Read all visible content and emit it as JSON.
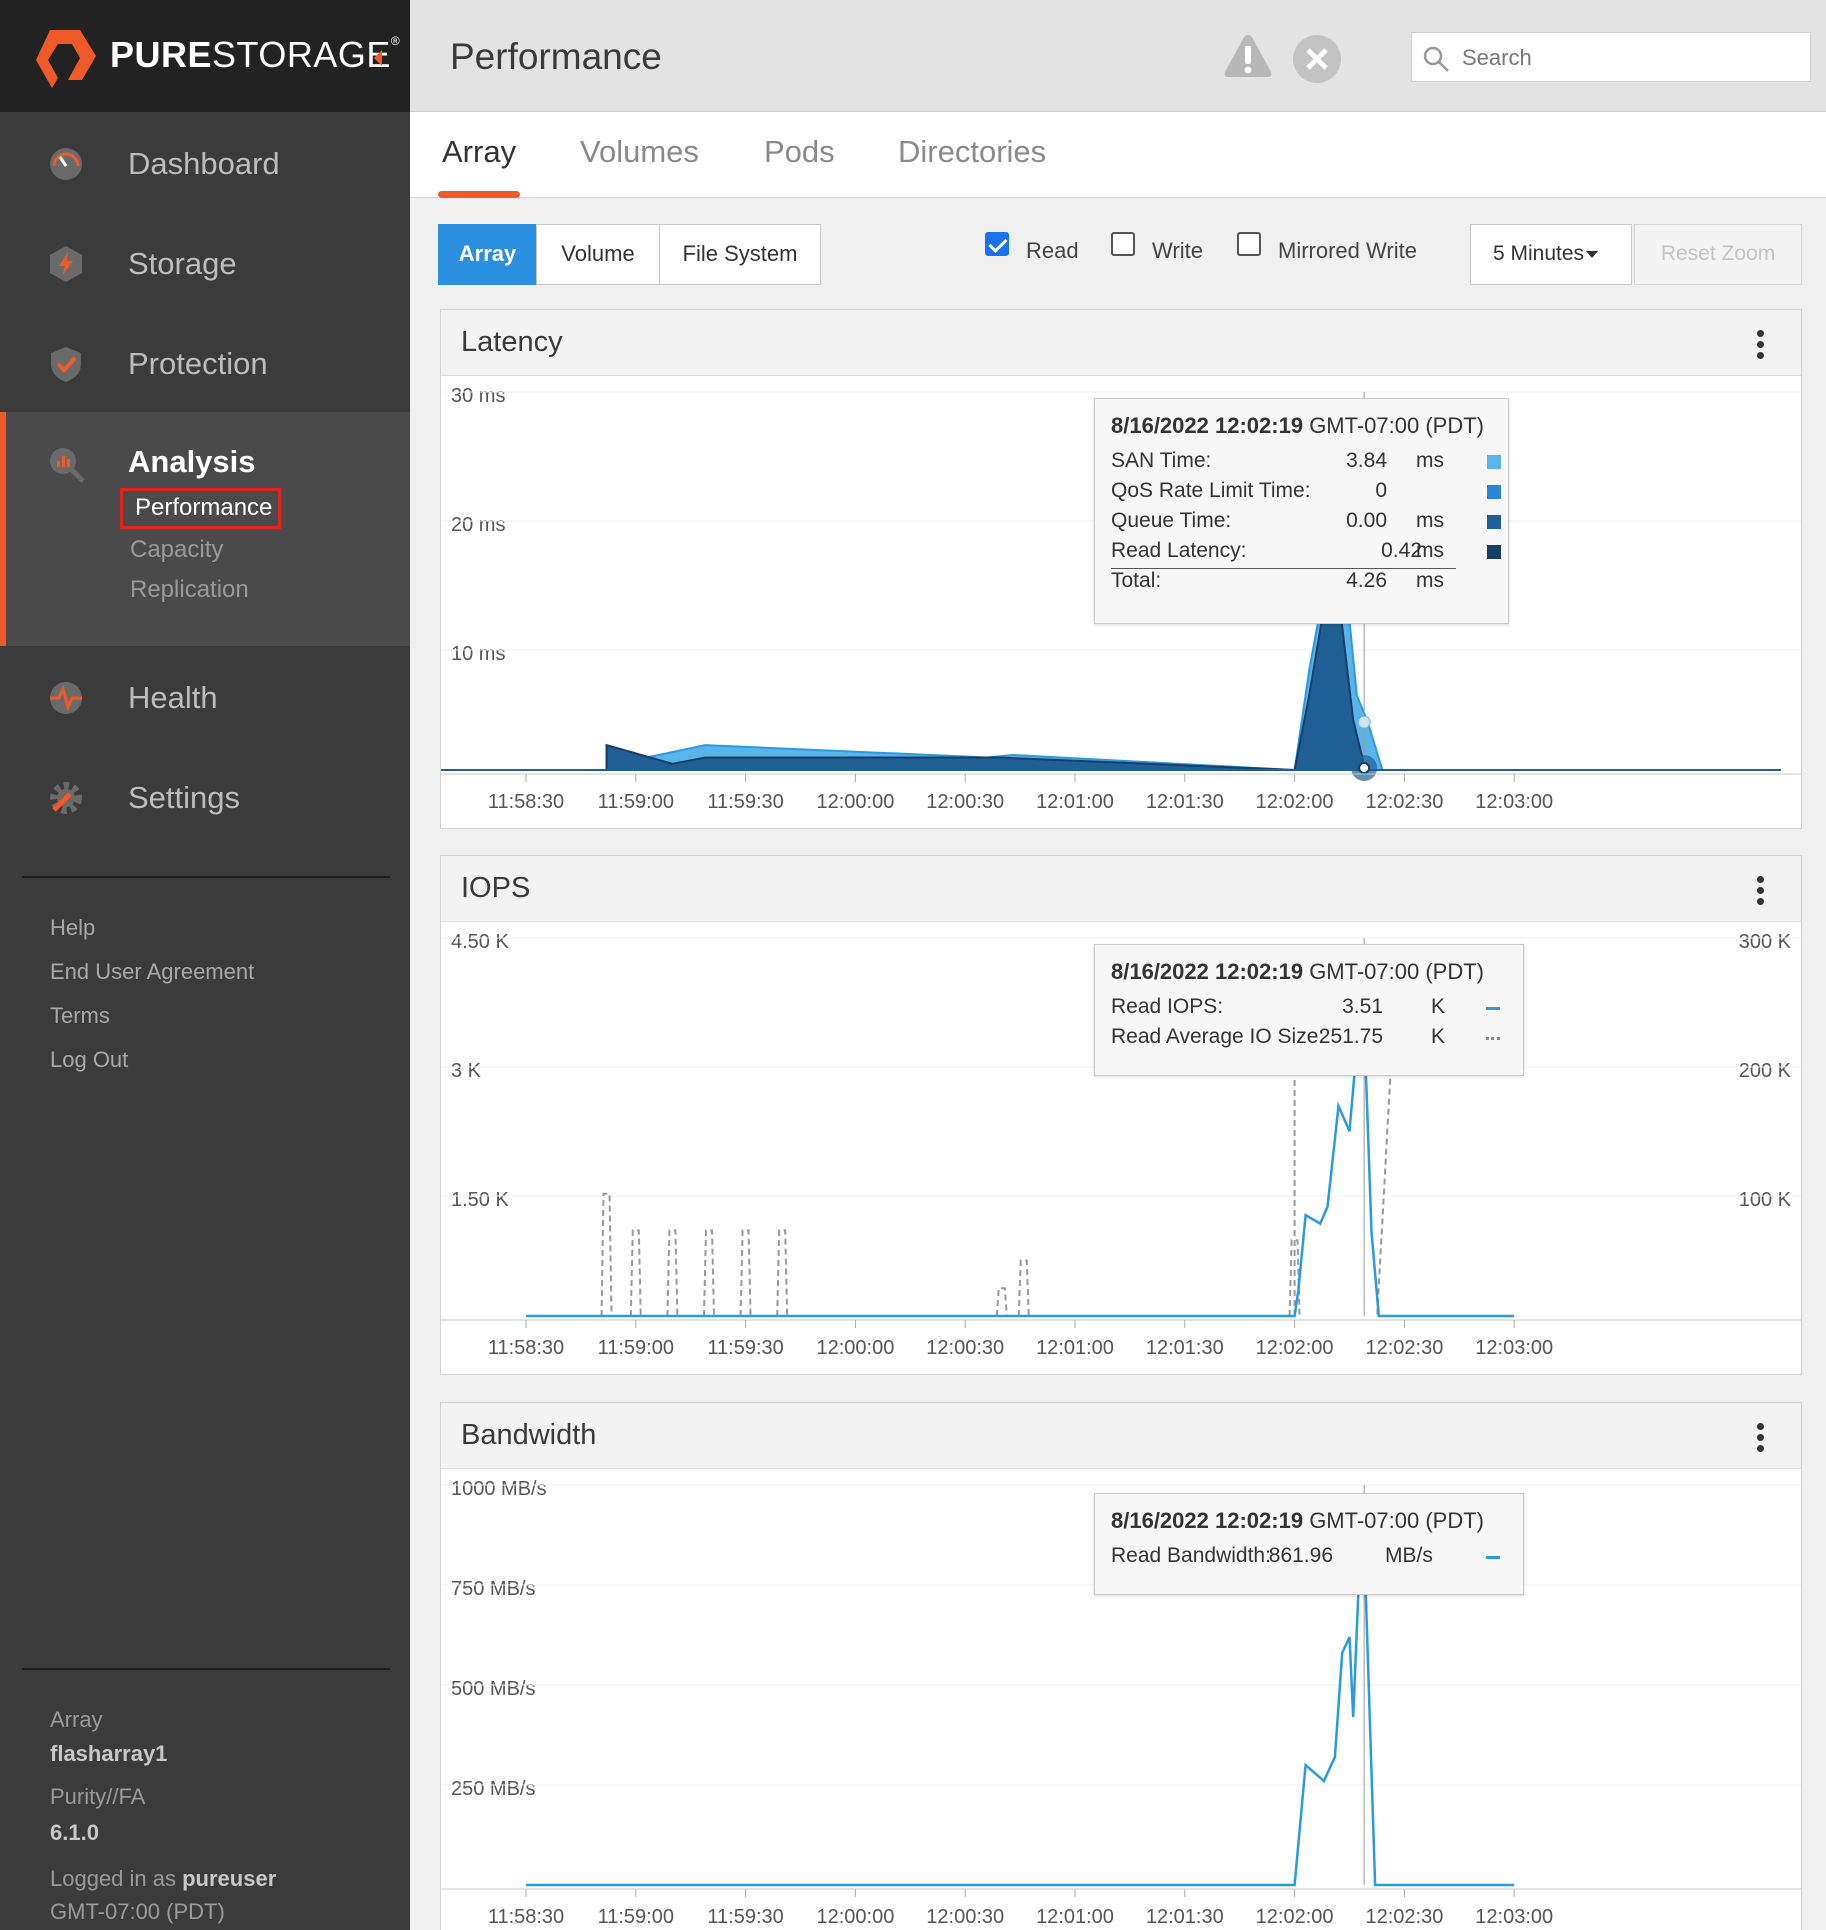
{
  "brand": {
    "name_bold": "PURE",
    "name_light": "STORAGE",
    "mark": "®"
  },
  "sidebar": {
    "nav": [
      {
        "label": "Dashboard",
        "icon": "dashboard-gauge-icon"
      },
      {
        "label": "Storage",
        "icon": "storage-bolt-icon"
      },
      {
        "label": "Protection",
        "icon": "shield-check-icon"
      },
      {
        "label": "Analysis",
        "icon": "analysis-magnifier-icon"
      },
      {
        "label": "Health",
        "icon": "health-pulse-icon"
      },
      {
        "label": "Settings",
        "icon": "gear-icon"
      }
    ],
    "analysis_sub": [
      "Performance",
      "Capacity",
      "Replication"
    ],
    "links": [
      "Help",
      "End User Agreement",
      "Terms",
      "Log Out"
    ],
    "footer": {
      "array_label": "Array",
      "array_name": "flasharray1",
      "purity_label": "Purity//FA",
      "purity_version": "6.1.0",
      "logged_in_prefix": "Logged in as ",
      "user": "pureuser",
      "timezone": "GMT-07:00 (PDT)"
    }
  },
  "header": {
    "title": "Performance",
    "search_placeholder": "Search"
  },
  "tabs": [
    "Array",
    "Volumes",
    "Pods",
    "Directories"
  ],
  "toolbar": {
    "segments": [
      "Array",
      "Volume",
      "File System"
    ],
    "checkboxes": [
      {
        "label": "Read",
        "checked": true
      },
      {
        "label": "Write",
        "checked": false
      },
      {
        "label": "Mirrored Write",
        "checked": false
      }
    ],
    "range": "5 Minutes",
    "reset_zoom": "Reset Zoom"
  },
  "colors": {
    "accent": "#f05a28",
    "read_line": "#2b9be0",
    "san_time": "#5ab4ec",
    "qos": "#2a86d4",
    "queue": "#1f5f96",
    "read_latency": "#183f63"
  },
  "x_ticks": [
    "11:58:30",
    "11:59:00",
    "11:59:30",
    "12:00:00",
    "12:00:30",
    "12:01:00",
    "12:01:30",
    "12:02:00",
    "12:02:30",
    "12:03:00"
  ],
  "panels": {
    "latency": {
      "title": "Latency",
      "y_ticks": [
        "30 ms",
        "20 ms",
        "10 ms"
      ],
      "tooltip": {
        "time": "8/16/2022 12:02:19",
        "tz": "GMT-07:00 (PDT)",
        "rows": [
          {
            "key": "SAN Time:",
            "value": "3.84",
            "unit": "ms"
          },
          {
            "key": "QoS Rate Limit Time:",
            "value": "0",
            "unit": ""
          },
          {
            "key": "Queue Time:",
            "value": "0.00",
            "unit": "ms"
          },
          {
            "key": "Read Latency:",
            "value": "0.42",
            "unit": "ms"
          },
          {
            "key": "Total:",
            "value": "4.26",
            "unit": "ms"
          }
        ]
      }
    },
    "iops": {
      "title": "IOPS",
      "y_ticks_left": [
        "4.50 K",
        "3 K",
        "1.50 K"
      ],
      "y_ticks_right": [
        "300 K",
        "200 K",
        "100 K"
      ],
      "tooltip": {
        "time": "8/16/2022 12:02:19",
        "tz": "GMT-07:00 (PDT)",
        "rows": [
          {
            "key": "Read IOPS:",
            "value": "3.51",
            "unit": "K"
          },
          {
            "key": "Read Average IO Size:",
            "value": "251.75",
            "unit": "K"
          }
        ]
      }
    },
    "bandwidth": {
      "title": "Bandwidth",
      "y_ticks": [
        "1000 MB/s",
        "750 MB/s",
        "500 MB/s",
        "250 MB/s"
      ],
      "tooltip": {
        "time": "8/16/2022 12:02:19",
        "tz": "GMT-07:00 (PDT)",
        "rows": [
          {
            "key": "Read Bandwidth:",
            "value": "861.96",
            "unit": "MB/s"
          }
        ]
      }
    }
  },
  "chart_data": [
    {
      "type": "area",
      "title": "Latency",
      "x": [
        "11:58:30",
        "11:59:00",
        "11:59:30",
        "12:00:00",
        "12:00:30",
        "12:01:00",
        "12:01:30",
        "12:02:00",
        "12:02:30",
        "12:03:00"
      ],
      "ylim": [
        0,
        30
      ],
      "series": [
        {
          "name": "SAN Time",
          "points": [
            [
              "11:58:52",
              0
            ],
            [
              "11:59:03",
              1
            ],
            [
              "11:59:19",
              2
            ],
            [
              "12:00:36",
              1
            ],
            [
              "12:00:43",
              1.2
            ],
            [
              "12:02:00",
              0
            ],
            [
              "12:02:04",
              8
            ],
            [
              "12:02:09",
              16
            ],
            [
              "12:02:14",
              15
            ],
            [
              "12:02:17",
              6
            ],
            [
              "12:02:20",
              3.84
            ],
            [
              "12:02:24",
              0
            ]
          ]
        },
        {
          "name": "Read Latency",
          "points": [
            [
              "11:58:52",
              2
            ],
            [
              "11:59:10",
              0.5
            ],
            [
              "11:59:19",
              1
            ],
            [
              "12:00:39",
              1
            ],
            [
              "12:02:00",
              0
            ],
            [
              "12:02:04",
              6
            ],
            [
              "12:02:08",
              13
            ],
            [
              "12:02:12",
              14
            ],
            [
              "12:02:16",
              4
            ],
            [
              "12:02:19",
              0.42
            ],
            [
              "12:02:20",
              0
            ]
          ]
        }
      ]
    },
    {
      "type": "line",
      "title": "IOPS",
      "x": [
        "11:58:30",
        "11:59:00",
        "11:59:30",
        "12:00:00",
        "12:00:30",
        "12:01:00",
        "12:01:30",
        "12:02:00",
        "12:02:30",
        "12:03:00"
      ],
      "ylim": [
        0,
        4.5
      ],
      "ylim_right": [
        0,
        300
      ],
      "series": [
        {
          "name": "Read IOPS",
          "points": [
            [
              "11:58:30",
              0
            ],
            [
              "12:02:00",
              0
            ],
            [
              "12:02:01",
              0.3
            ],
            [
              "12:02:03",
              1.2
            ],
            [
              "12:02:07",
              1.1
            ],
            [
              "12:02:09",
              1.3
            ],
            [
              "12:02:12",
              2.5
            ],
            [
              "12:02:15",
              2.2
            ],
            [
              "12:02:17",
              3.2
            ],
            [
              "12:02:19",
              3.51
            ],
            [
              "12:02:21",
              1.0
            ],
            [
              "12:02:23",
              0
            ],
            [
              "12:03:00",
              0
            ]
          ]
        },
        {
          "name": "Read Average IO Size",
          "points": [
            [
              "11:58:52",
              97
            ],
            [
              "11:59:00",
              68
            ],
            [
              "11:59:10",
              68
            ],
            [
              "11:59:20",
              68
            ],
            [
              "11:59:30",
              68
            ],
            [
              "11:59:40",
              68
            ],
            [
              "12:00:40",
              22
            ],
            [
              "12:00:46",
              44
            ],
            [
              "12:02:00",
              60
            ],
            [
              "12:02:17",
              251.75
            ],
            [
              "12:02:22",
              251.75
            ]
          ]
        }
      ]
    },
    {
      "type": "line",
      "title": "Bandwidth",
      "x": [
        "11:58:30",
        "11:59:00",
        "11:59:30",
        "12:00:00",
        "12:00:30",
        "12:01:00",
        "12:01:30",
        "12:02:00",
        "12:02:30",
        "12:03:00"
      ],
      "ylim": [
        0,
        1000
      ],
      "series": [
        {
          "name": "Read Bandwidth",
          "points": [
            [
              "11:58:30",
              0
            ],
            [
              "12:02:00",
              0
            ],
            [
              "12:02:03",
              300
            ],
            [
              "12:02:08",
              260
            ],
            [
              "12:02:11",
              320
            ],
            [
              "12:02:13",
              580
            ],
            [
              "12:02:15",
              620
            ],
            [
              "12:02:16",
              420
            ],
            [
              "12:02:18",
              860
            ],
            [
              "12:02:19",
              861.96
            ],
            [
              "12:02:22",
              0
            ],
            [
              "12:03:00",
              0
            ]
          ]
        }
      ]
    }
  ]
}
